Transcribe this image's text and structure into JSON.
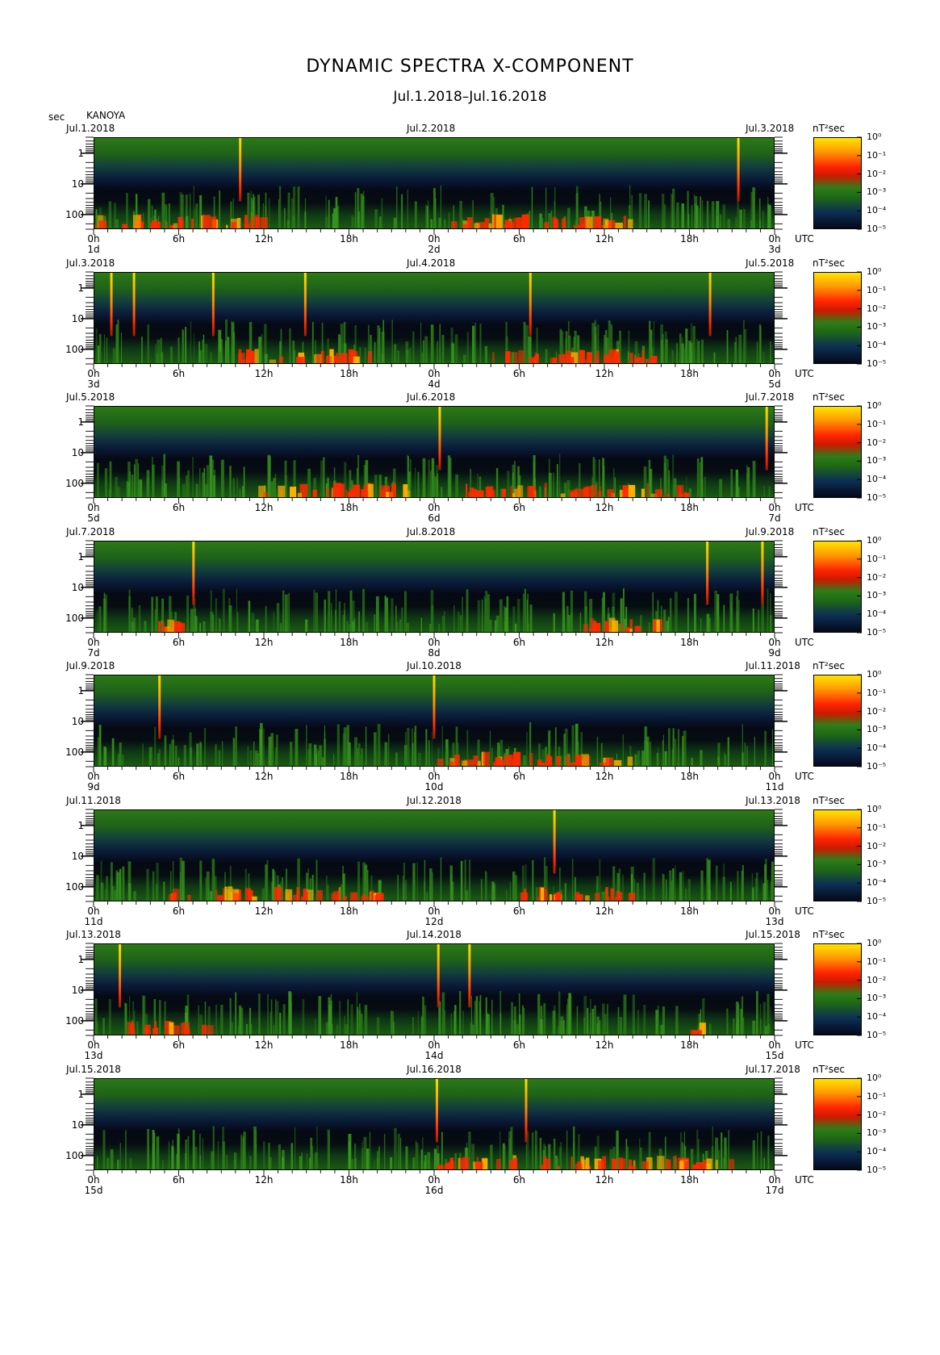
{
  "title": "DYNAMIC SPECTRA X-COMPONENT",
  "subtitle": "Jul.1.2018–Jul.16.2018",
  "y_unit": "sec",
  "station": "KANOYA",
  "colorbar_unit": "nT²sec",
  "colorbar_ticks": [
    "10⁰",
    "10⁻¹",
    "10⁻²",
    "10⁻³",
    "10⁻⁴",
    "10⁻⁵"
  ],
  "x_ticks": [
    "0h",
    "6h",
    "12h",
    "18h",
    "0h",
    "6h",
    "12h",
    "18h",
    "0h"
  ],
  "x_unit": "UTC",
  "colors": {
    "spike": "#ffd000",
    "red": "#ff2a00",
    "green": "#2c8a1a",
    "background": "#06091a"
  },
  "chart_data": {
    "type": "heatmap",
    "title": "DYNAMIC SPECTRA X-COMPONENT",
    "subtitle": "Jul.1.2018–Jul.16.2018",
    "station": "KANOYA",
    "component": "X",
    "ylabel": "sec",
    "y_scale": "log",
    "y_ticks": [
      1,
      10,
      100
    ],
    "ylim": [
      0.3,
      300
    ],
    "xlabel": "UTC",
    "x_ticks_hours": [
      0,
      6,
      12,
      18,
      24,
      30,
      36,
      42,
      48
    ],
    "colorbar_label": "nT²sec",
    "colorbar_range": [
      "1e-5",
      "1e0"
    ],
    "grid": false,
    "panels": [
      {
        "date_left": "Jul.1.2018",
        "date_mid": "Jul.2.2018",
        "date_right": "Jul.3.2018",
        "day_labels": [
          "1d",
          "2d",
          "3d"
        ],
        "spikes_hours": [
          10.3,
          45.5
        ],
        "red_bands": [
          [
            0,
            12
          ],
          [
            25,
            38
          ]
        ]
      },
      {
        "date_left": "Jul.3.2018",
        "date_mid": "Jul.4.2018",
        "date_right": "Jul.5.2018",
        "day_labels": [
          "3d",
          "4d",
          "5d"
        ],
        "spikes_hours": [
          1.2,
          2.8,
          8.4,
          14.9,
          30.8,
          43.5
        ],
        "red_bands": [
          [
            10,
            20
          ],
          [
            28,
            40
          ]
        ]
      },
      {
        "date_left": "Jul.5.2018",
        "date_mid": "Jul.6.2018",
        "date_right": "Jul.7.2018",
        "day_labels": [
          "5d",
          "6d",
          "7d"
        ],
        "spikes_hours": [
          24.4,
          47.5
        ],
        "red_bands": [
          [
            11,
            22
          ],
          [
            26,
            42
          ]
        ]
      },
      {
        "date_left": "Jul.7.2018",
        "date_mid": "Jul.8.2018",
        "date_right": "Jul.9.2018",
        "day_labels": [
          "7d",
          "8d",
          "9d"
        ],
        "spikes_hours": [
          7.0,
          43.3,
          47.2
        ],
        "red_bands": [
          [
            3,
            6
          ],
          [
            34,
            40
          ]
        ]
      },
      {
        "date_left": "Jul.9.2018",
        "date_mid": "Jul.10.2018",
        "date_right": "Jul.11.2018",
        "day_labels": [
          "9d",
          "10d",
          "11d"
        ],
        "spikes_hours": [
          4.6,
          24.0
        ],
        "red_bands": [
          [
            24,
            38
          ]
        ]
      },
      {
        "date_left": "Jul.11.2018",
        "date_mid": "Jul.12.2018",
        "date_right": "Jul.13.2018",
        "day_labels": [
          "11d",
          "12d",
          "13d"
        ],
        "spikes_hours": [
          32.5
        ],
        "red_bands": [
          [
            5,
            20
          ],
          [
            30,
            38
          ]
        ]
      },
      {
        "date_left": "Jul.13.2018",
        "date_mid": "Jul.14.2018",
        "date_right": "Jul.15.2018",
        "day_labels": [
          "13d",
          "14d",
          "15d"
        ],
        "spikes_hours": [
          1.8,
          24.3,
          26.5
        ],
        "red_bands": [
          [
            2,
            8
          ],
          [
            42,
            43
          ]
        ]
      },
      {
        "date_left": "Jul.15.2018",
        "date_mid": "Jul.16.2018",
        "date_right": "Jul.17.2018",
        "day_labels": [
          "15d",
          "16d",
          "17d"
        ],
        "spikes_hours": [
          24.2,
          30.5
        ],
        "red_bands": [
          [
            24,
            45
          ]
        ]
      }
    ]
  }
}
